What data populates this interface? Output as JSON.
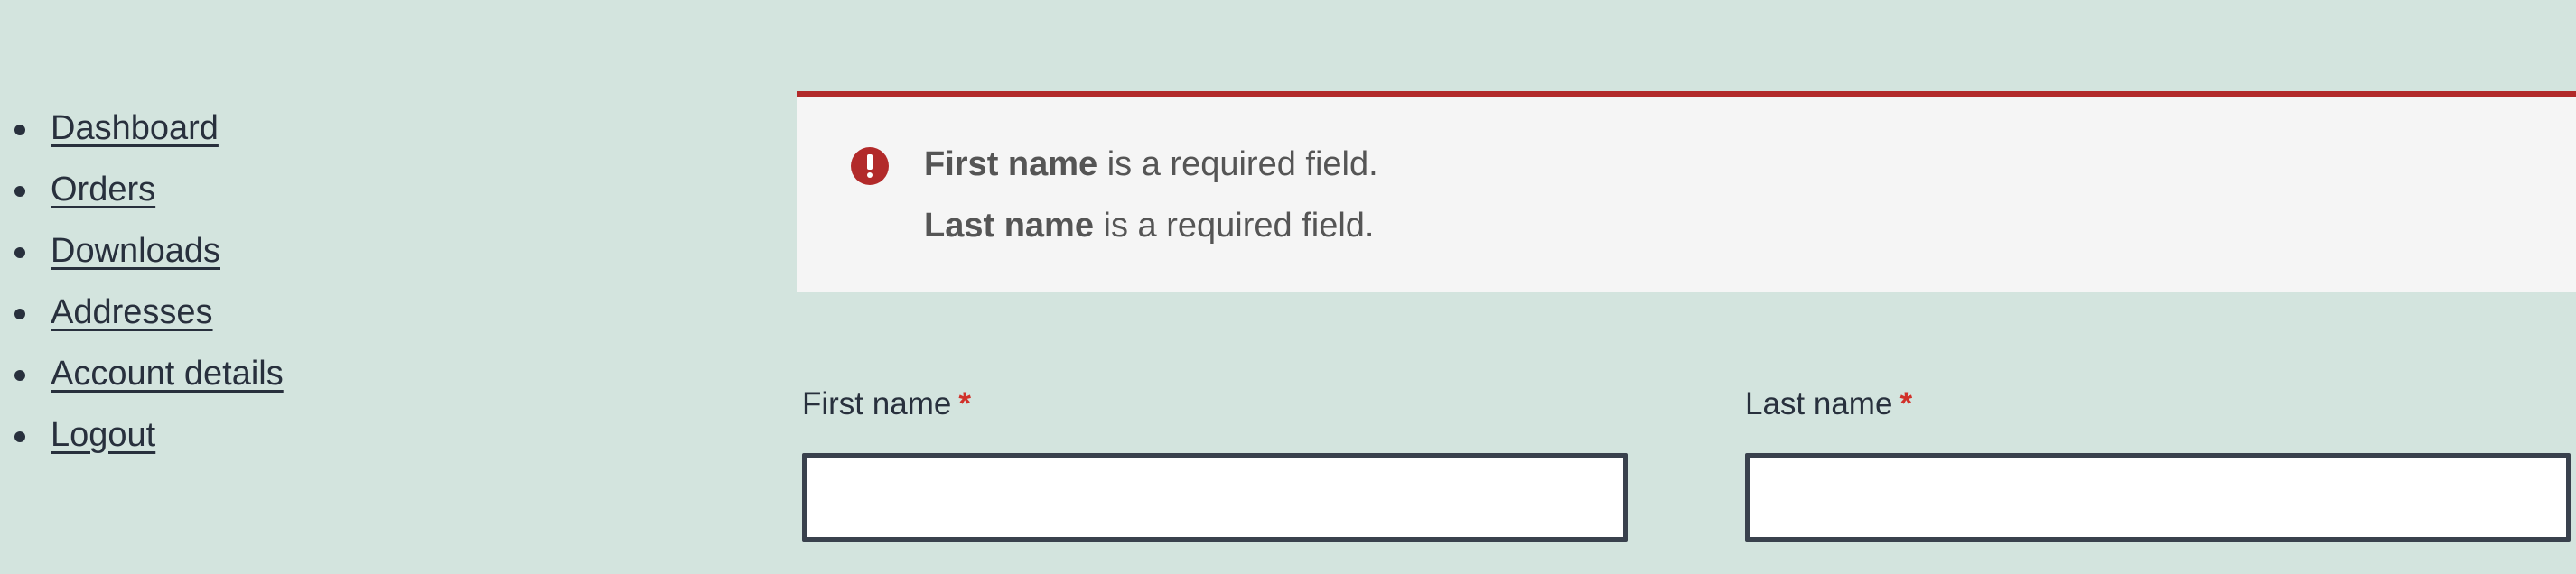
{
  "navigation": {
    "items": [
      {
        "label": "Dashboard"
      },
      {
        "label": "Orders"
      },
      {
        "label": "Downloads"
      },
      {
        "label": "Addresses"
      },
      {
        "label": "Account details"
      },
      {
        "label": "Logout"
      }
    ]
  },
  "notice": {
    "type": "error",
    "icon": "exclamation-icon",
    "accent_color": "#b22a2a",
    "errors": [
      {
        "field": "First name",
        "message": "is a required field."
      },
      {
        "field": "Last name",
        "message": "is a required field."
      }
    ]
  },
  "form": {
    "first_name": {
      "label": "First name",
      "required_marker": "*",
      "value": ""
    },
    "last_name": {
      "label": "Last name",
      "required_marker": "*",
      "value": ""
    }
  }
}
